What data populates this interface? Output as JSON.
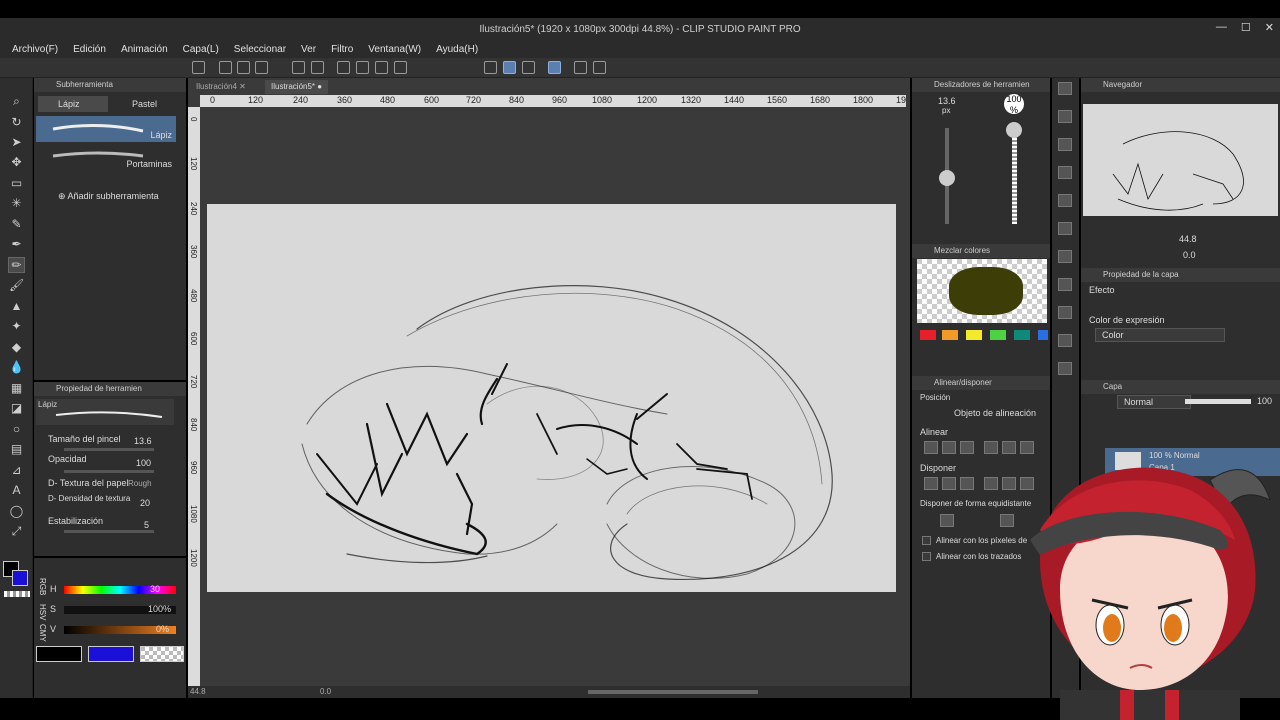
{
  "window": {
    "title": "Ilustración5* (1920 x 1080px 300dpi 44.8%) - CLIP STUDIO PAINT PRO",
    "min": "—",
    "max": "☐",
    "close": "✕"
  },
  "menu": [
    "Archivo(F)",
    "Edición",
    "Animación",
    "Capa(L)",
    "Seleccionar",
    "Ver",
    "Filtro",
    "Ventana(W)",
    "Ayuda(H)"
  ],
  "subtool": {
    "panel_title": "Subherramienta",
    "tabs": [
      "Lápiz",
      "Pastel"
    ],
    "brushes": [
      "Lápiz",
      "Portaminas"
    ],
    "add_label": "Añadir subherramienta"
  },
  "tool_property": {
    "panel_title": "Propiedad de herramien",
    "preview_label": "Lápiz",
    "brush_size_label": "Tamaño del pincel",
    "brush_size_value": "13.6",
    "opacity_label": "Opacidad",
    "opacity_value": "100",
    "paper_texture_label": "D- Textura del papel",
    "paper_texture_value": "Rough",
    "texture_density_label": "D- Densidad de textura",
    "texture_density_value": "20",
    "stabilization_label": "Estabilización",
    "stabilization_value": "5"
  },
  "color": {
    "h_label": "H",
    "h_value": "30",
    "s_label": "S",
    "s_value": "100",
    "v_label": "V",
    "v_value": "0",
    "pct": "%",
    "side_labels": [
      "RGB",
      "HSV",
      "CMY"
    ]
  },
  "canvas": {
    "tabs": [
      "Ilustración4",
      "Ilustración5*"
    ],
    "ruler_h": [
      "0",
      "120",
      "240",
      "360",
      "480",
      "600",
      "720",
      "840",
      "960",
      "1080",
      "1200",
      "1320",
      "1440",
      "1560",
      "1680",
      "1800",
      "19"
    ],
    "ruler_v": [
      "0",
      "120",
      "240",
      "360",
      "480",
      "600",
      "720",
      "840",
      "960",
      "1080",
      "1200"
    ],
    "zoom": "44.8",
    "rotation": "0.0"
  },
  "sliders_panel": {
    "title": "Deslizadores de herramien",
    "size_value": "13.6",
    "size_unit": "px",
    "opacity_value": "100",
    "opacity_unit": "%"
  },
  "mix_panel": {
    "title": "Mezclar colores"
  },
  "align_panel": {
    "title": "Alinear/disponer",
    "posicion": "Posición",
    "object": "Objeto de alineación",
    "align": "Alinear",
    "dispose": "Disponer",
    "equidistant": "Disponer de forma equidistante",
    "align_pixels": "Alinear con los píxeles de",
    "align_paths": "Alinear con los trazados"
  },
  "navigator": {
    "title": "Navegador",
    "zoom": "44.8",
    "rotation": "0.0"
  },
  "layer_property": {
    "title": "Propiedad de la capa",
    "effect": "Efecto",
    "expression_label": "Color de expresión",
    "expression_value": "Color"
  },
  "layer": {
    "title": "Capa",
    "blend": "Normal",
    "opacity": "100",
    "row_blend": "100 % Normal",
    "row_name": "Capa 1"
  },
  "colors": {
    "accent": "#5a7fb0",
    "main_color": "#000000",
    "sub_color": "#1a10d8",
    "mix_color": "#3d3d08",
    "swatches": [
      "#e5202a",
      "#f19a28",
      "#f3ea2c",
      "#4fd145",
      "#0f8a7a",
      "#2a6ee0"
    ]
  }
}
